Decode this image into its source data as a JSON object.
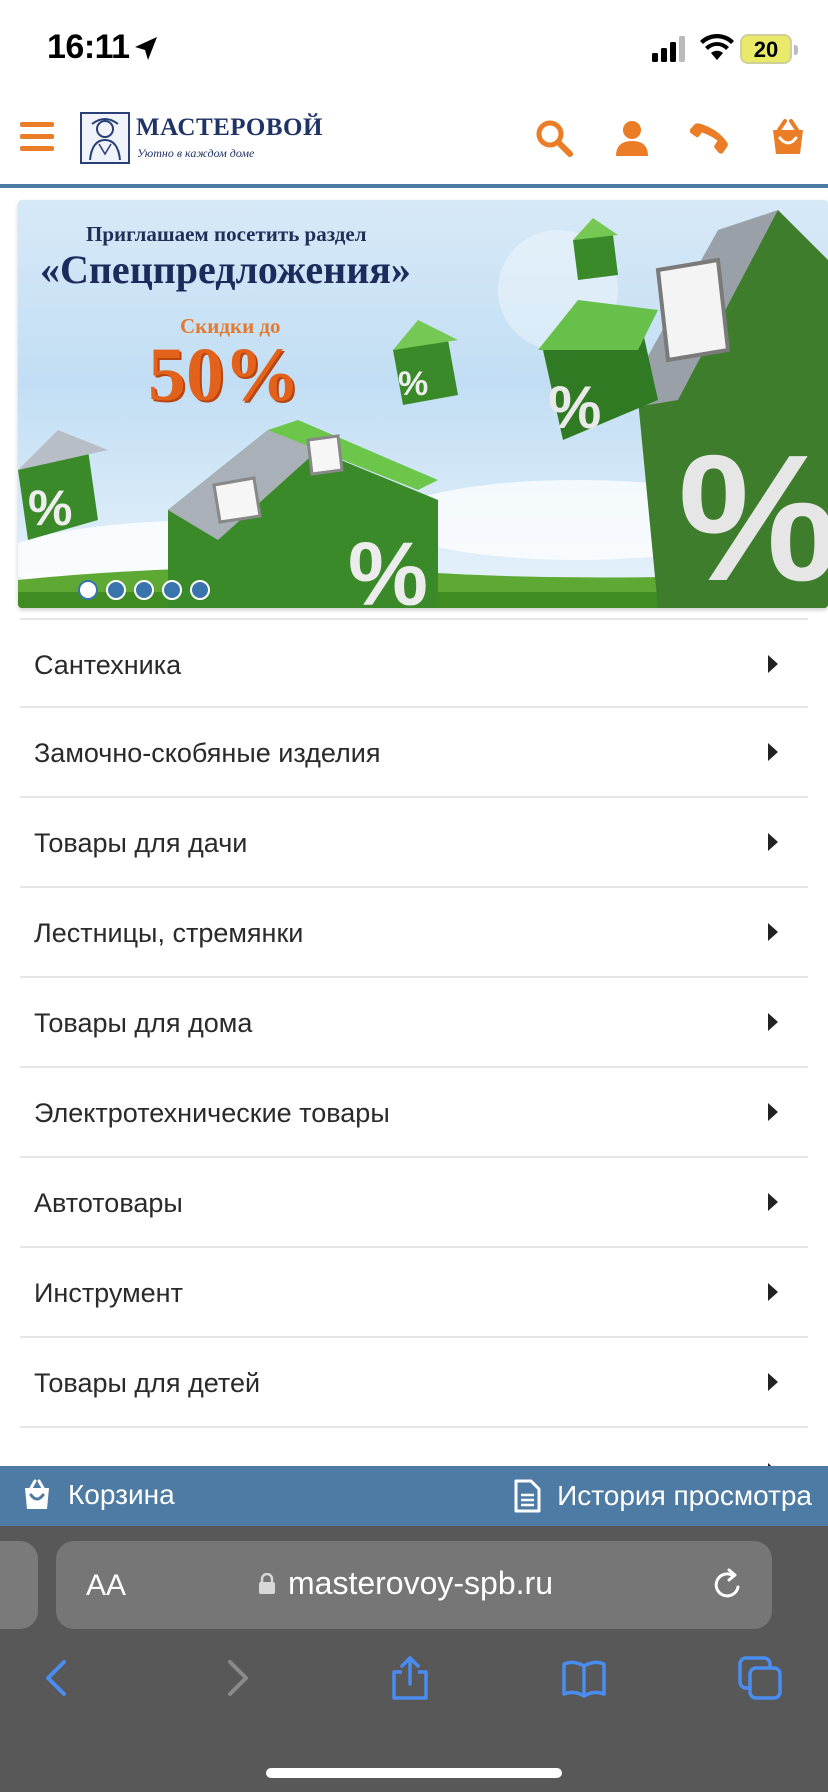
{
  "status_bar": {
    "time": "16:11",
    "battery": "20"
  },
  "header": {
    "logo_name": "МАСТЕРОВОЙ",
    "logo_slogan": "Уютно в каждом доме",
    "icons": [
      "menu-icon",
      "search-icon",
      "user-icon",
      "phone-icon",
      "cart-icon"
    ],
    "accent_color": "#ea7d25",
    "brand_color": "#4e7ba3"
  },
  "banner": {
    "invite": "Приглашаем посетить раздел",
    "title": "«Спецпредложения»",
    "discount_text": "Скидки до",
    "discount_value": "50%",
    "slide_count": 5,
    "active_slide": 1
  },
  "categories": [
    {
      "label": "Сантехника"
    },
    {
      "label": "Замочно-скобяные изделия"
    },
    {
      "label": "Товары для дачи"
    },
    {
      "label": "Лестницы, стремянки"
    },
    {
      "label": "Товары для дома"
    },
    {
      "label": "Электротехнические товары"
    },
    {
      "label": "Автотовары"
    },
    {
      "label": "Инструмент"
    },
    {
      "label": "Товары для детей"
    }
  ],
  "bottom_bar": {
    "cart_label": "Корзина",
    "history_label": "История просмотра"
  },
  "browser": {
    "aa_label": "AA",
    "url": "masterovoy-spb.ru"
  }
}
